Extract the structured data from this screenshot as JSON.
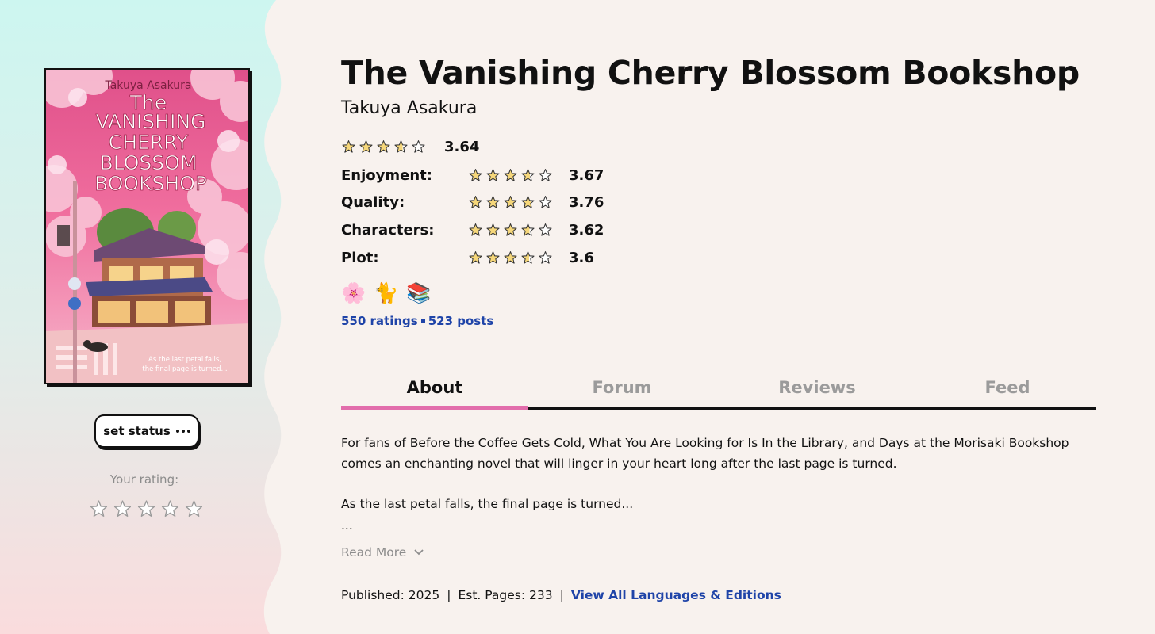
{
  "book": {
    "title": "The Vanishing Cherry Blossom Bookshop",
    "author": "Takuya Asakura",
    "cover": {
      "author_text": "Takuya Asakura",
      "title_lines": [
        "The",
        "VANISHING",
        "CHERRY",
        "BLOSSOM",
        "BOOKSHOP"
      ],
      "tagline_lines": [
        "As the last petal falls,",
        "the final page is turned..."
      ]
    }
  },
  "rating": {
    "overall": {
      "value": "3.64",
      "stars": 3.64
    },
    "sub": [
      {
        "label": "Enjoyment:",
        "value": "3.67",
        "stars": 3.67
      },
      {
        "label": "Quality:",
        "value": "3.76",
        "stars": 3.76
      },
      {
        "label": "Characters:",
        "value": "3.62",
        "stars": 3.62
      },
      {
        "label": "Plot:",
        "value": "3.6",
        "stars": 3.6
      }
    ]
  },
  "emojis": [
    "🌸",
    "🐈",
    "📚"
  ],
  "counts": {
    "ratings": "550 ratings",
    "posts": "523 posts"
  },
  "tabs": [
    {
      "label": "About",
      "active": true
    },
    {
      "label": "Forum",
      "active": false
    },
    {
      "label": "Reviews",
      "active": false
    },
    {
      "label": "Feed",
      "active": false
    }
  ],
  "description": {
    "line1": "For fans of Before the Coffee Gets Cold, What You Are Looking for Is In the Library, and Days at the Morisaki Bookshop",
    "line2": "comes an enchanting novel that will linger in your heart long after the last page is turned.",
    "line3": "As the last petal falls, the final page is turned...",
    "ellipsis": "...",
    "read_more": "Read More"
  },
  "meta": {
    "published": "Published: 2025",
    "pages": "Est. Pages: 233",
    "editions_link": "View All Languages & Editions"
  },
  "sidebar": {
    "set_status": "set status",
    "your_rating_label": "Your rating:",
    "your_rating_stars": 0
  },
  "colors": {
    "accent_tab": "#e26dab",
    "link": "#1f44a8",
    "star_fill": "#f6d77a",
    "panel_top": "#cdf6f0",
    "panel_bottom": "#f8dfdf",
    "page_bg": "#f8f2ee"
  }
}
